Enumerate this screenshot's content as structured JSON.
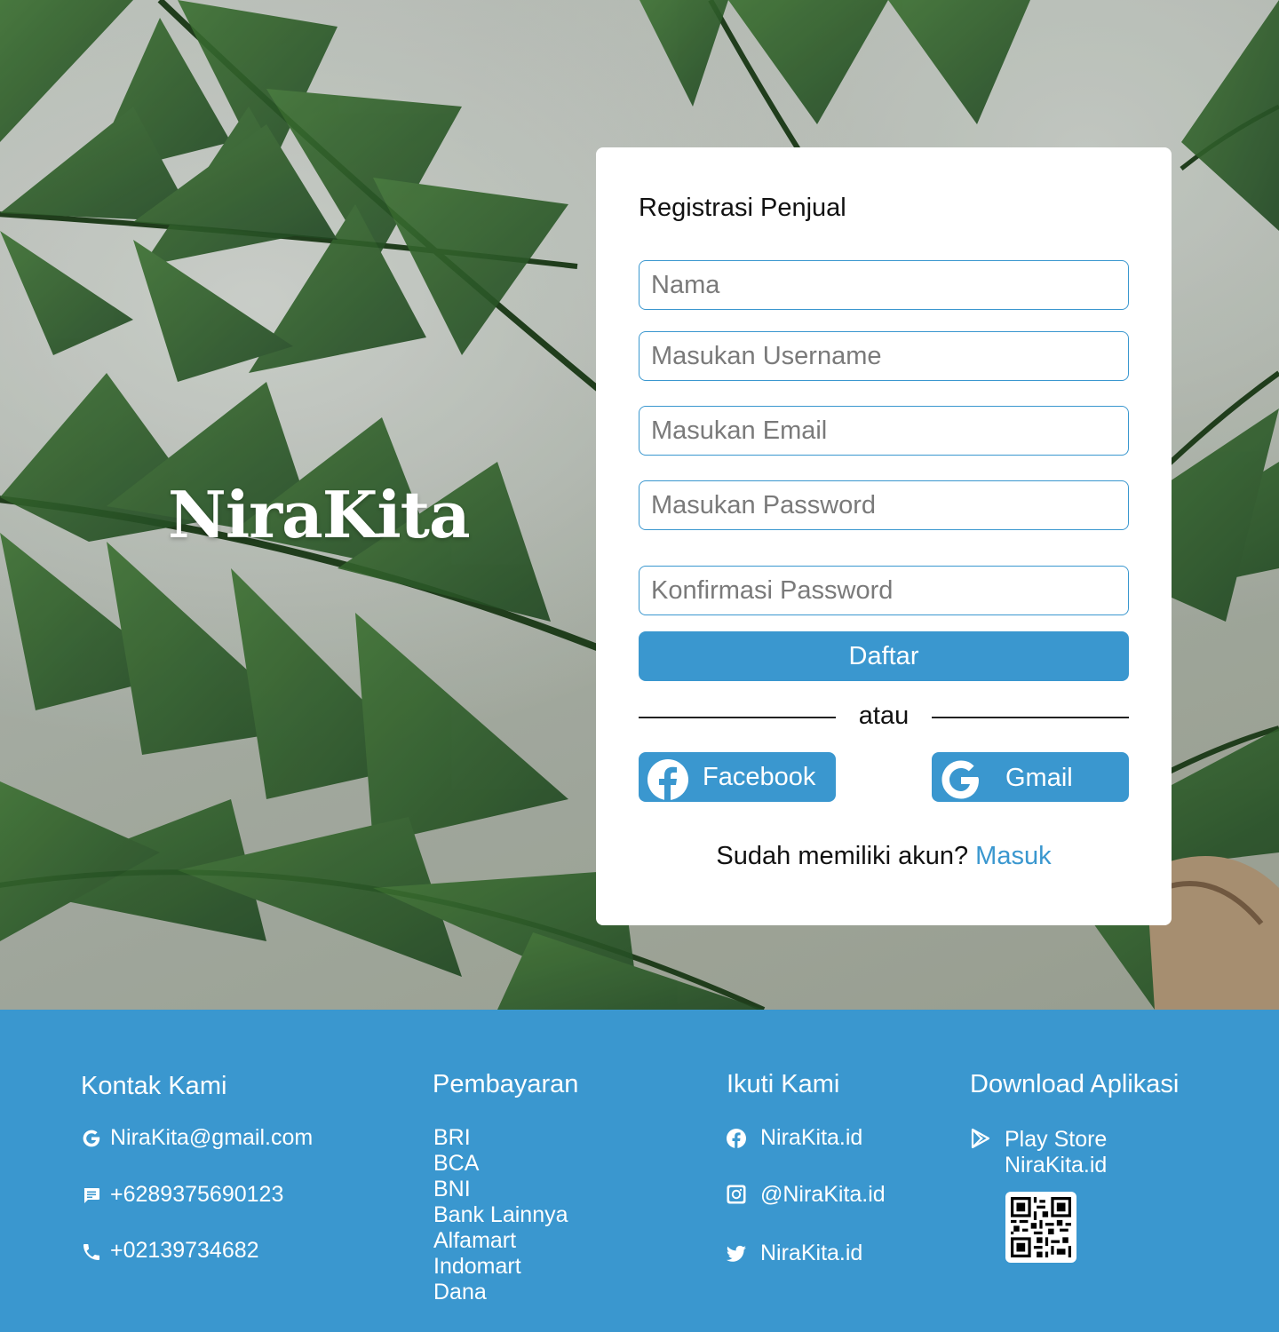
{
  "brand": "NiraKita",
  "form": {
    "title": "Registrasi Penjual",
    "name_placeholder": "Nama",
    "username_placeholder": "Masukan Username",
    "email_placeholder": "Masukan Email",
    "password_placeholder": "Masukan Password",
    "confirm_placeholder": "Konfirmasi Password",
    "submit_label": "Daftar",
    "divider": "atau",
    "facebook_label": "Facebook",
    "gmail_label": "Gmail",
    "has_account": "Sudah memiliki akun?",
    "login_link": "Masuk"
  },
  "footer": {
    "contact": {
      "title": "Kontak Kami",
      "email": "NiraKita@gmail.com",
      "sms": "+6289375690123",
      "phone": "+02139734682"
    },
    "payment": {
      "title": "Pembayaran",
      "items": [
        "BRI",
        "BCA",
        "BNI",
        "Bank Lainnya",
        "Alfamart",
        "Indomart",
        "Dana"
      ]
    },
    "follow": {
      "title": "Ikuti Kami",
      "facebook": "NiraKita.id",
      "instagram": "@NiraKita.id",
      "twitter": "NiraKita.id"
    },
    "download": {
      "title": "Download Aplikasi",
      "store_line1": "Play Store",
      "store_line2": "NiraKita.id"
    }
  },
  "colors": {
    "accent": "#3a97cf",
    "card": "#ffffff",
    "text": "#111111"
  },
  "icons": [
    "google-icon",
    "message-icon",
    "phone-icon",
    "facebook-icon",
    "instagram-icon",
    "twitter-icon",
    "play-store-icon",
    "qr-code"
  ]
}
